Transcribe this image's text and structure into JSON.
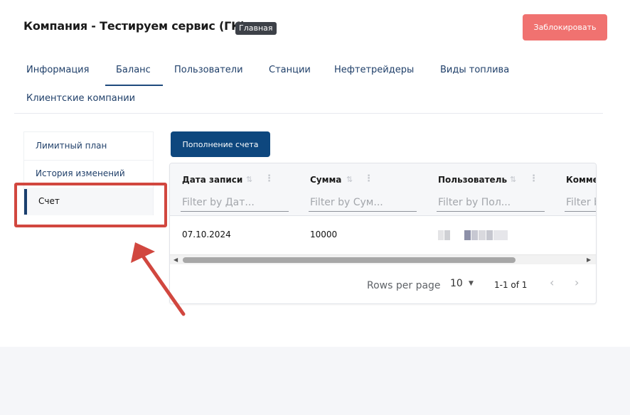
{
  "header": {
    "title": "Компания - Тестируем сервис (ГК)",
    "badge": "Главная",
    "block_button": "Заблокировать"
  },
  "tabs": [
    {
      "label": "Информация",
      "active": false
    },
    {
      "label": "Баланс",
      "active": true
    },
    {
      "label": "Пользователи",
      "active": false
    },
    {
      "label": "Станции",
      "active": false
    },
    {
      "label": "Нефтетрейдеры",
      "active": false
    },
    {
      "label": "Виды топлива",
      "active": false
    },
    {
      "label": "Клиентские компании",
      "active": false
    }
  ],
  "side_menu": {
    "items": [
      {
        "label": "Лимитный план",
        "active": false
      },
      {
        "label": "История изменений",
        "active": false
      },
      {
        "label": "Счет",
        "active": true
      }
    ]
  },
  "topup_button": "Пополнение счета",
  "grid": {
    "columns": [
      {
        "title": "Дата записи",
        "filter_placeholder": "Filter by Дат..."
      },
      {
        "title": "Сумма",
        "filter_placeholder": "Filter by Сум..."
      },
      {
        "title": "Пользователь",
        "filter_placeholder": "Filter by Пол..."
      },
      {
        "title": "Комме",
        "filter_placeholder": "Filter b"
      }
    ],
    "rows": [
      {
        "date": "07.10.2024",
        "amount": "10000",
        "user": "",
        "comment": ""
      }
    ],
    "footer": {
      "rows_per_page_label": "Rows per page",
      "rows_per_page_value": "10",
      "range": "1-1 of 1"
    }
  },
  "colors": {
    "accent": "#0e477e",
    "danger_button": "#f07270",
    "annotation": "#d1473f"
  }
}
